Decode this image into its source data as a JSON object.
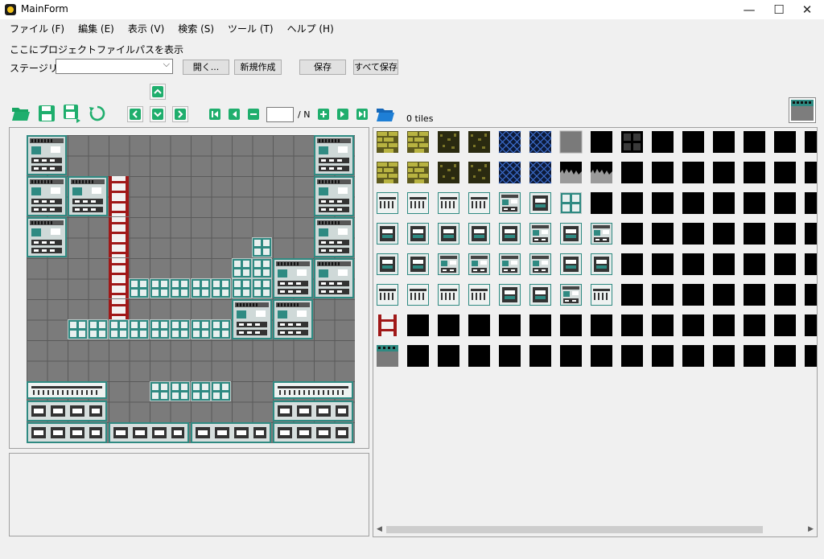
{
  "window": {
    "title": "MainForm",
    "minimize": "—",
    "maximize": "☐",
    "close": "✕"
  },
  "menu": [
    {
      "label": "ファイル (F)"
    },
    {
      "label": "編集 (E)"
    },
    {
      "label": "表示 (V)"
    },
    {
      "label": "検索 (S)"
    },
    {
      "label": "ツール (T)"
    },
    {
      "label": "ヘルプ (H)"
    }
  ],
  "project": {
    "path_label": "ここにプロジェクトファイルパスを表示",
    "stage_list_label": "ステージリスト",
    "stage_selected": ""
  },
  "buttons": {
    "open": "開く...",
    "new": "新規作成",
    "save": "保存",
    "save_all": "すべて保存"
  },
  "pager": {
    "current": "",
    "total": "/ N"
  },
  "palette": {
    "count_label": "0 tiles"
  },
  "icons": {
    "open": "folder-open-icon",
    "save": "floppy-disk-icon",
    "save_as": "floppy-disk-arrow-icon",
    "reload": "refresh-icon",
    "scroll_up": "chevron-up-icon",
    "scroll_left": "chevron-left-icon",
    "scroll_down": "chevron-down-icon",
    "scroll_right": "chevron-right-icon",
    "first": "skip-first-icon",
    "prev": "play-prev-icon",
    "remove": "minus-icon",
    "add": "plus-icon",
    "next": "play-next-icon",
    "last": "skip-last-icon",
    "folder": "folder-blue-icon"
  },
  "colors": {
    "accent": "#1fae6d",
    "folder_blue": "#1e7fd6",
    "map_bg": "#7b7b7b",
    "tile_teal": "#2f8a82",
    "ladder_red": "#a01818"
  }
}
